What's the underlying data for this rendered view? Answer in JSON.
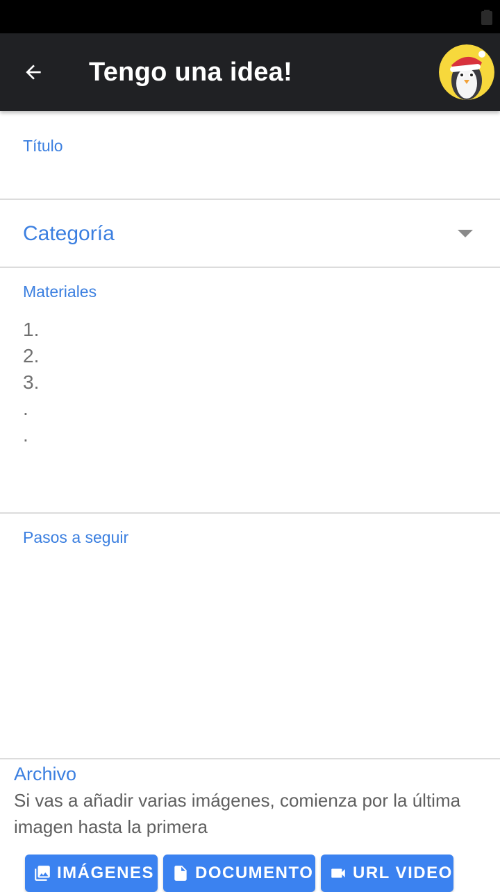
{
  "app_bar": {
    "title": "Tengo una idea!",
    "background": "#202124"
  },
  "form": {
    "titulo": {
      "label": "Título",
      "value": ""
    },
    "categoria": {
      "label": "Categoría"
    },
    "materiales": {
      "label": "Materiales",
      "placeholder": "1.\n2.\n3.\n.\n."
    },
    "pasos": {
      "label": "Pasos a seguir",
      "value": ""
    }
  },
  "archivo": {
    "title": "Archivo",
    "hint": "Si vas a añadir varias imágenes, comienza por la última imagen hasta la primera"
  },
  "buttons": {
    "imagenes": {
      "label": "IMÁGENES",
      "icon": "image-icon"
    },
    "documento": {
      "label": "DOCUMENTO",
      "icon": "document-icon"
    },
    "video": {
      "label": "URL VIDEO",
      "icon": "videocam-icon"
    }
  },
  "colors": {
    "accent": "#3b7fe0",
    "button": "#3b82f0",
    "divider": "#dcdcdc",
    "avatar_bg": "#f7d83c"
  }
}
